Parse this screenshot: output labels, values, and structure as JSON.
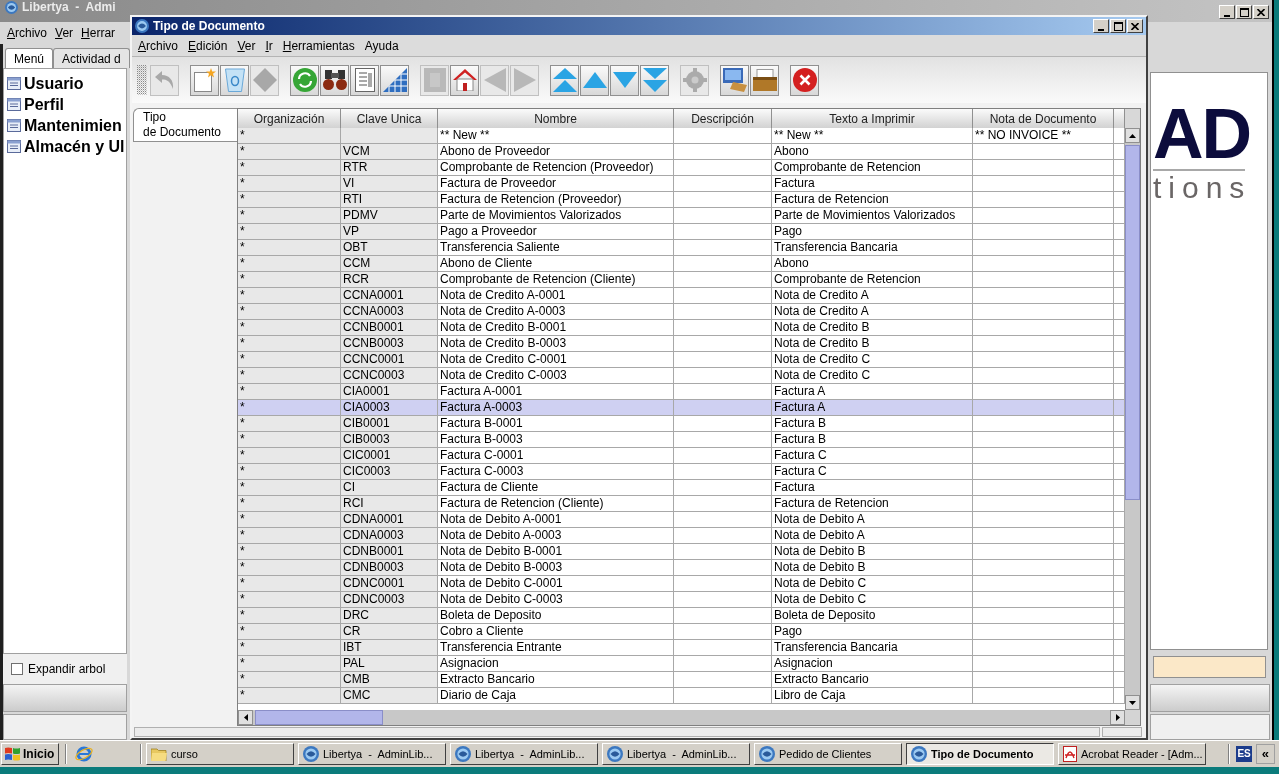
{
  "background_window": {
    "title": "Libertya  -  Admi",
    "menu": [
      {
        "label": "Archivo",
        "mnemonic": true
      },
      {
        "label": "Ver",
        "mnemonic": true
      },
      {
        "label": "Herrar",
        "mnemonic": true
      }
    ],
    "tabs": [
      {
        "label": "Menú",
        "selected": true
      },
      {
        "label": "Actividad d",
        "selected": false
      }
    ],
    "tree": [
      {
        "label": "Usuario"
      },
      {
        "label": "Perfil"
      },
      {
        "label": "Mantenimien"
      },
      {
        "label": "Almacén y Ul"
      }
    ],
    "expand_tree": {
      "label": "Expandir arbol",
      "checked": false
    },
    "logo": {
      "mark": "AD",
      "tagline": "tions"
    }
  },
  "window": {
    "title": "Tipo de Documento",
    "menu": [
      {
        "label": "Archivo",
        "mnemonic": true
      },
      {
        "label": "Edición",
        "mnemonic": true
      },
      {
        "label": "Ver",
        "mnemonic": true
      },
      {
        "label": "Ir",
        "mnemonic": true
      },
      {
        "label": "Herramientas",
        "mnemonic": true
      },
      {
        "label": "Ayuda",
        "mnemonic": false
      }
    ],
    "toolbar_groups": [
      {
        "buttons": [
          {
            "kind": "undo",
            "disabled": true
          }
        ]
      },
      {
        "buttons": [
          {
            "kind": "new",
            "disabled": false
          },
          {
            "kind": "delete",
            "disabled": false
          },
          {
            "kind": "save",
            "disabled": true
          }
        ]
      },
      {
        "buttons": [
          {
            "kind": "refresh",
            "disabled": false
          },
          {
            "kind": "find",
            "disabled": false
          },
          {
            "kind": "report",
            "disabled": false
          },
          {
            "kind": "grid",
            "disabled": false
          }
        ]
      },
      {
        "buttons": [
          {
            "kind": "history",
            "disabled": true
          },
          {
            "kind": "home",
            "disabled": false
          },
          {
            "kind": "back",
            "disabled": true
          },
          {
            "kind": "forward",
            "disabled": true
          }
        ]
      },
      {
        "buttons": [
          {
            "kind": "first",
            "disabled": false
          },
          {
            "kind": "previous",
            "disabled": false
          },
          {
            "kind": "next",
            "disabled": false
          },
          {
            "kind": "last",
            "disabled": false
          }
        ]
      },
      {
        "buttons": [
          {
            "kind": "gear",
            "disabled": true
          }
        ]
      },
      {
        "buttons": [
          {
            "kind": "print",
            "disabled": false
          },
          {
            "kind": "archive",
            "disabled": false
          }
        ]
      },
      {
        "buttons": [
          {
            "kind": "exit",
            "disabled": false
          }
        ]
      }
    ],
    "side_tabs": [
      {
        "label_lines": [
          "Tipo",
          "de Documento"
        ],
        "selected": true
      }
    ],
    "table": {
      "columns": [
        "Organización",
        "Clave Unica",
        "Nombre",
        "Descripción",
        "Texto a Imprimir",
        "Nota de Documento"
      ],
      "rows": [
        {
          "organization": "*",
          "name": "** New **",
          "print_text": "** New **",
          "document_note": "** NO INVOICE **",
          "selected": false
        },
        {
          "organization": "*",
          "search_key": "VCM",
          "name": "Abono de Proveedor",
          "print_text": "Abono",
          "selected": false
        },
        {
          "organization": "*",
          "search_key": "RTR",
          "name": "Comprobante de Retencion (Proveedor)",
          "print_text": "Comprobante de Retencion",
          "selected": false
        },
        {
          "organization": "*",
          "search_key": "VI",
          "name": "Factura de Proveedor",
          "print_text": "Factura",
          "selected": false
        },
        {
          "organization": "*",
          "search_key": "RTI",
          "name": "Factura de Retencion (Proveedor)",
          "print_text": "Factura de Retencion",
          "selected": false
        },
        {
          "organization": "*",
          "search_key": "PDMV",
          "name": "Parte de Movimientos Valorizados",
          "print_text": "Parte de Movimientos Valorizados",
          "selected": false
        },
        {
          "organization": "*",
          "search_key": "VP",
          "name": "Pago a Proveedor",
          "print_text": "Pago",
          "selected": false
        },
        {
          "organization": "*",
          "search_key": "OBT",
          "name": "Transferencia Saliente",
          "print_text": "Transferencia Bancaria",
          "selected": false
        },
        {
          "organization": "*",
          "search_key": "CCM",
          "name": "Abono de Cliente",
          "print_text": "Abono",
          "selected": false
        },
        {
          "organization": "*",
          "search_key": "RCR",
          "name": "Comprobante de Retencion (Cliente)",
          "print_text": "Comprobante de Retencion",
          "selected": false
        },
        {
          "organization": "*",
          "search_key": "CCNA0001",
          "name": "Nota de Credito A-0001",
          "print_text": "Nota de Credito A",
          "selected": false
        },
        {
          "organization": "*",
          "search_key": "CCNA0003",
          "name": "Nota de Credito A-0003",
          "print_text": "Nota de Credito A",
          "selected": false
        },
        {
          "organization": "*",
          "search_key": "CCNB0001",
          "name": "Nota de Credito B-0001",
          "print_text": "Nota de Credito B",
          "selected": false
        },
        {
          "organization": "*",
          "search_key": "CCNB0003",
          "name": "Nota de Credito B-0003",
          "print_text": "Nota de Credito B",
          "selected": false
        },
        {
          "organization": "*",
          "search_key": "CCNC0001",
          "name": "Nota de Credito C-0001",
          "print_text": "Nota de Credito C",
          "selected": false
        },
        {
          "organization": "*",
          "search_key": "CCNC0003",
          "name": "Nota de Credito C-0003",
          "print_text": "Nota de Credito C",
          "selected": false
        },
        {
          "organization": "*",
          "search_key": "CIA0001",
          "name": "Factura A-0001",
          "print_text": "Factura A",
          "selected": false
        },
        {
          "organization": "*",
          "search_key": "CIA0003",
          "name": "Factura A-0003",
          "print_text": "Factura A",
          "selected": true
        },
        {
          "organization": "*",
          "search_key": "CIB0001",
          "name": "Factura B-0001",
          "print_text": "Factura B",
          "selected": false
        },
        {
          "organization": "*",
          "search_key": "CIB0003",
          "name": "Factura B-0003",
          "print_text": "Factura B",
          "selected": false
        },
        {
          "organization": "*",
          "search_key": "CIC0001",
          "name": "Factura C-0001",
          "print_text": "Factura C",
          "selected": false
        },
        {
          "organization": "*",
          "search_key": "CIC0003",
          "name": "Factura C-0003",
          "print_text": "Factura C",
          "selected": false
        },
        {
          "organization": "*",
          "search_key": "CI",
          "name": "Factura de Cliente",
          "print_text": "Factura",
          "selected": false
        },
        {
          "organization": "*",
          "search_key": "RCI",
          "name": "Factura de Retencion (Cliente)",
          "print_text": "Factura de Retencion",
          "selected": false
        },
        {
          "organization": "*",
          "search_key": "CDNA0001",
          "name": "Nota de Debito A-0001",
          "print_text": "Nota de Debito A",
          "selected": false
        },
        {
          "organization": "*",
          "search_key": "CDNA0003",
          "name": "Nota de Debito A-0003",
          "print_text": "Nota de Debito A",
          "selected": false
        },
        {
          "organization": "*",
          "search_key": "CDNB0001",
          "name": "Nota de Debito B-0001",
          "print_text": "Nota de Debito B",
          "selected": false
        },
        {
          "organization": "*",
          "search_key": "CDNB0003",
          "name": "Nota de Debito B-0003",
          "print_text": "Nota de Debito B",
          "selected": false
        },
        {
          "organization": "*",
          "search_key": "CDNC0001",
          "name": "Nota de Debito C-0001",
          "print_text": "Nota de Debito C",
          "selected": false
        },
        {
          "organization": "*",
          "search_key": "CDNC0003",
          "name": "Nota de Debito C-0003",
          "print_text": "Nota de Debito C",
          "selected": false
        },
        {
          "organization": "*",
          "search_key": "DRC",
          "name": "Boleta de Deposito",
          "print_text": "Boleta de Deposito",
          "selected": false
        },
        {
          "organization": "*",
          "search_key": "CR",
          "name": "Cobro a Cliente",
          "print_text": "Pago",
          "selected": false
        },
        {
          "organization": "*",
          "search_key": "IBT",
          "name": "Transferencia Entrante",
          "print_text": "Transferencia Bancaria",
          "selected": false
        },
        {
          "organization": "*",
          "search_key": "PAL",
          "name": "Asignacion",
          "print_text": "Asignacion",
          "selected": false
        },
        {
          "organization": "*",
          "search_key": "CMB",
          "name": "Extracto Bancario",
          "print_text": "Extracto Bancario",
          "selected": false
        },
        {
          "organization": "*",
          "search_key": "CMC",
          "name": "Diario de Caja",
          "print_text": "Libro de Caja",
          "selected": false
        }
      ]
    }
  },
  "taskbar": {
    "start": "Inicio",
    "items": [
      {
        "label": "curso",
        "kind": "folder",
        "selected": false
      },
      {
        "label": "Libertya  -  AdminLib...",
        "kind": "app",
        "selected": false
      },
      {
        "label": "Libertya  -  AdminLib...",
        "kind": "app",
        "selected": false
      },
      {
        "label": "Libertya  -  AdminLib...",
        "kind": "app",
        "selected": false
      },
      {
        "label": "Pedido de Clientes",
        "kind": "app",
        "selected": false
      },
      {
        "label": "Tipo de Documento",
        "kind": "app",
        "selected": true
      },
      {
        "label": "Acrobat Reader - [Adm...",
        "kind": "pdf",
        "selected": false
      }
    ],
    "language": "ES",
    "show_more": "«"
  }
}
